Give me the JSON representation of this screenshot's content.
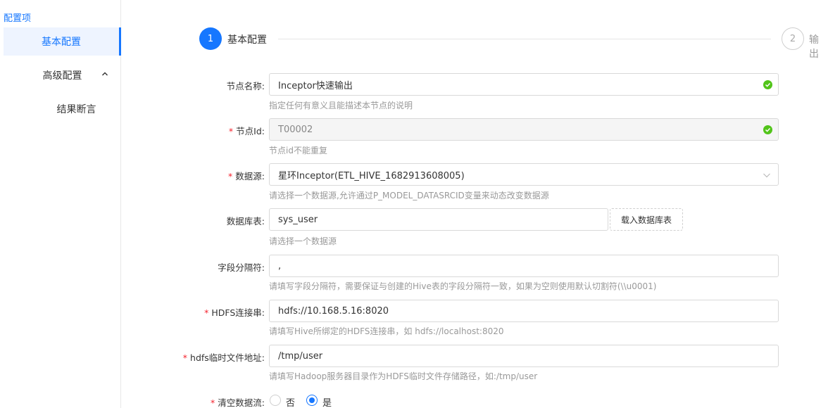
{
  "sidebar": {
    "title": "配置项",
    "items": [
      {
        "label": "基本配置"
      },
      {
        "label": "高级配置"
      },
      {
        "label": "结果断言"
      }
    ]
  },
  "steps": [
    {
      "number": "1",
      "label": "基本配置"
    },
    {
      "number": "2",
      "label": "输出"
    }
  ],
  "form": {
    "node_name": {
      "label": "节点名称:",
      "value": "Inceptor快速输出",
      "hint": "指定任何有意义且能描述本节点的说明"
    },
    "node_id": {
      "label": "节点Id:",
      "value": "T00002",
      "hint": "节点id不能重复"
    },
    "datasource": {
      "label": "数据源:",
      "value": "星环Inceptor(ETL_HIVE_1682913608005)",
      "hint": "请选择一个数据源,允许通过P_MODEL_DATASRCID变量来动态改变数据源"
    },
    "table": {
      "label": "数据库表:",
      "value": "sys_user",
      "button": "载入数据库表",
      "hint": "请选择一个数据源"
    },
    "delimiter": {
      "label": "字段分隔符:",
      "value": ",",
      "hint": "请填写字段分隔符，需要保证与创建的Hive表的字段分隔符一致，如果为空则使用默认切割符(\\\\u0001)"
    },
    "hdfs": {
      "label": "HDFS连接串:",
      "value": "hdfs://10.168.5.16:8020",
      "hint": "请填写Hive所绑定的HDFS连接串，如 hdfs://localhost:8020"
    },
    "tmp_path": {
      "label": "hdfs临时文件地址:",
      "value": "/tmp/user",
      "hint": "请填写Hadoop服务器目录作为HDFS临时文件存储路径，如:/tmp/user"
    },
    "clear": {
      "label": "清空数据流:",
      "options": [
        "否",
        "是"
      ],
      "selected": "是"
    }
  },
  "colors": {
    "accent": "#1677ff",
    "required": "#f5222d",
    "success": "#52c41a"
  }
}
